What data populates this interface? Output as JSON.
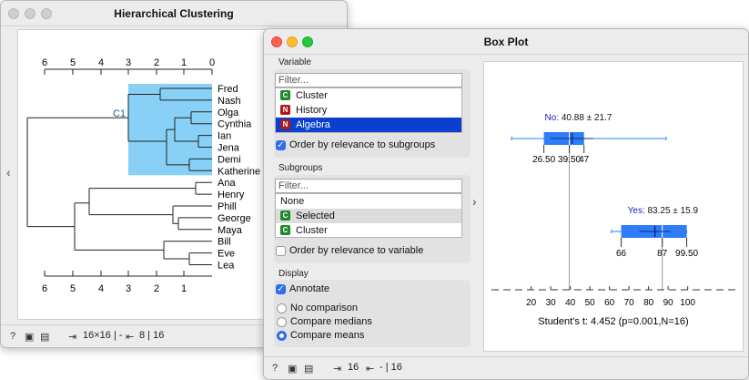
{
  "hc": {
    "title": "Hierarchical Clustering",
    "axis_ticks": [
      "6",
      "5",
      "4",
      "3",
      "2",
      "1",
      "0"
    ],
    "bottom_ticks": [
      "6",
      "5",
      "4",
      "3",
      "2",
      "1"
    ],
    "cluster_label": "C1",
    "leaves": [
      "Fred",
      "Nash",
      "Olga",
      "Cynthia",
      "Ian",
      "Jena",
      "Demi",
      "Katherine",
      "Ana",
      "Henry",
      "Phill",
      "George",
      "Maya",
      "Bill",
      "Eve",
      "Lea"
    ],
    "status": {
      "size": "16×16 | -",
      "output": "8 | 16"
    }
  },
  "bp": {
    "title": "Box Plot",
    "variable_label": "Variable",
    "filter_placeholder": "Filter...",
    "variables": [
      {
        "badge": "C",
        "name": "Cluster"
      },
      {
        "badge": "N",
        "name": "History"
      },
      {
        "badge": "N",
        "name": "Algebra"
      }
    ],
    "order_subgroups": "Order by relevance to subgroups",
    "subgroups_label": "Subgroups",
    "subgroups": [
      {
        "badge": "",
        "name": "None"
      },
      {
        "badge": "C",
        "name": "Selected"
      },
      {
        "badge": "C",
        "name": "Cluster"
      }
    ],
    "order_variable": "Order by relevance to variable",
    "display_label": "Display",
    "annotate": "Annotate",
    "comparisons": [
      "No comparison",
      "Compare medians",
      "Compare means"
    ],
    "status": {
      "input": "16",
      "output": "- | 16"
    }
  },
  "chart_data": {
    "type": "box",
    "boxes": [
      {
        "label": "No",
        "stat": "40.88 ± 21.7",
        "q1": 26.5,
        "median": 39.5,
        "q3": 47,
        "mean": 40.88,
        "sd": 21.7,
        "wlow": 10,
        "whigh": 89,
        "tick_labels": [
          "26.50",
          "39.50",
          "47"
        ]
      },
      {
        "label": "Yes",
        "stat": "83.25 ± 15.9",
        "q1": 66,
        "median": 87,
        "q3": 99.5,
        "mean": 83.25,
        "sd": 15.9,
        "wlow": 61,
        "whigh": 99.5,
        "tick_labels": [
          "66",
          "87",
          "99.50"
        ]
      }
    ],
    "axis_ticks": [
      20,
      30,
      40,
      50,
      60,
      70,
      80,
      90,
      100
    ],
    "xlim": [
      9,
      109
    ],
    "footer": "Student's t: 4.452 (p=0.001,N=16)",
    "colors": {
      "box": "#2e7cf6",
      "label": "#1a1ab8"
    }
  }
}
